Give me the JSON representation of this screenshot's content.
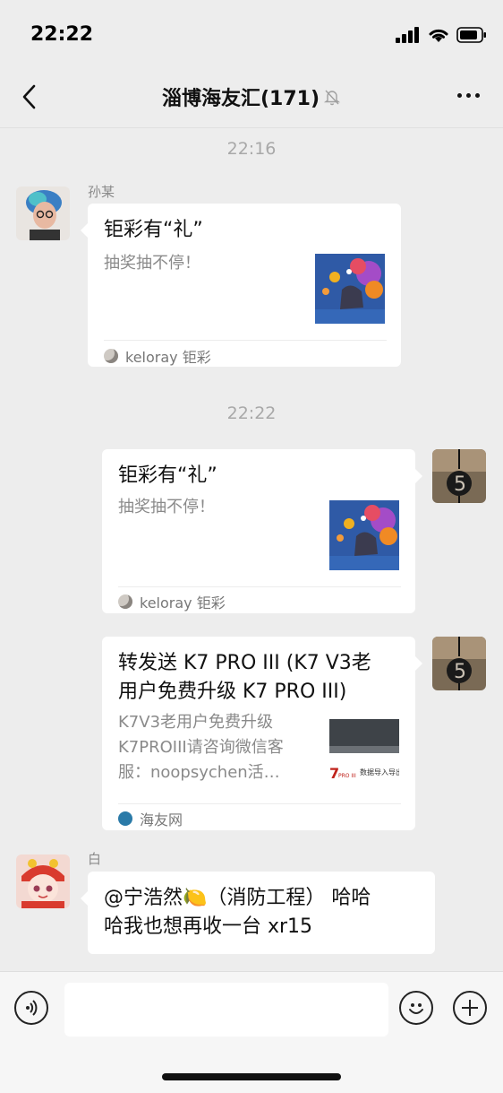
{
  "status_bar": {
    "time": "22:22"
  },
  "nav": {
    "title": "淄博海友汇(171)"
  },
  "timestamps": [
    "22:16",
    "22:22"
  ],
  "messages": [
    {
      "sender": "孙某",
      "card": {
        "title": "钜彩有“礼”",
        "desc": "抽奖抽不停！",
        "source": "keloray 钜彩"
      }
    },
    {
      "card": {
        "title": "钜彩有“礼”",
        "desc": "抽奖抽不停！",
        "source": "keloray 钜彩"
      }
    },
    {
      "card": {
        "title_line1": "转发送 K7 PRO III (K7 V3老",
        "title_line2": "用户免费升级 K7 PRO III)",
        "desc_line1": "K7V3老用户免费升级",
        "desc_line2": "K7PROIII请咨询微信客",
        "desc_line3": "服：noopsychen活…",
        "source": "海友网",
        "thumb_caption": "数据导入导出"
      }
    },
    {
      "sender": "白",
      "text_line1": "@宁浩然🍋（消防工程） 哈哈",
      "text_line2": "哈我也想再收一台 xr15"
    }
  ],
  "icons": {
    "back": "back-chevron-icon",
    "mute": "bell-muted-icon",
    "more": "more-dots-icon",
    "voice": "voice-icon",
    "emoji": "emoji-icon",
    "add": "plus-icon"
  },
  "input": {
    "value": "",
    "placeholder": ""
  }
}
